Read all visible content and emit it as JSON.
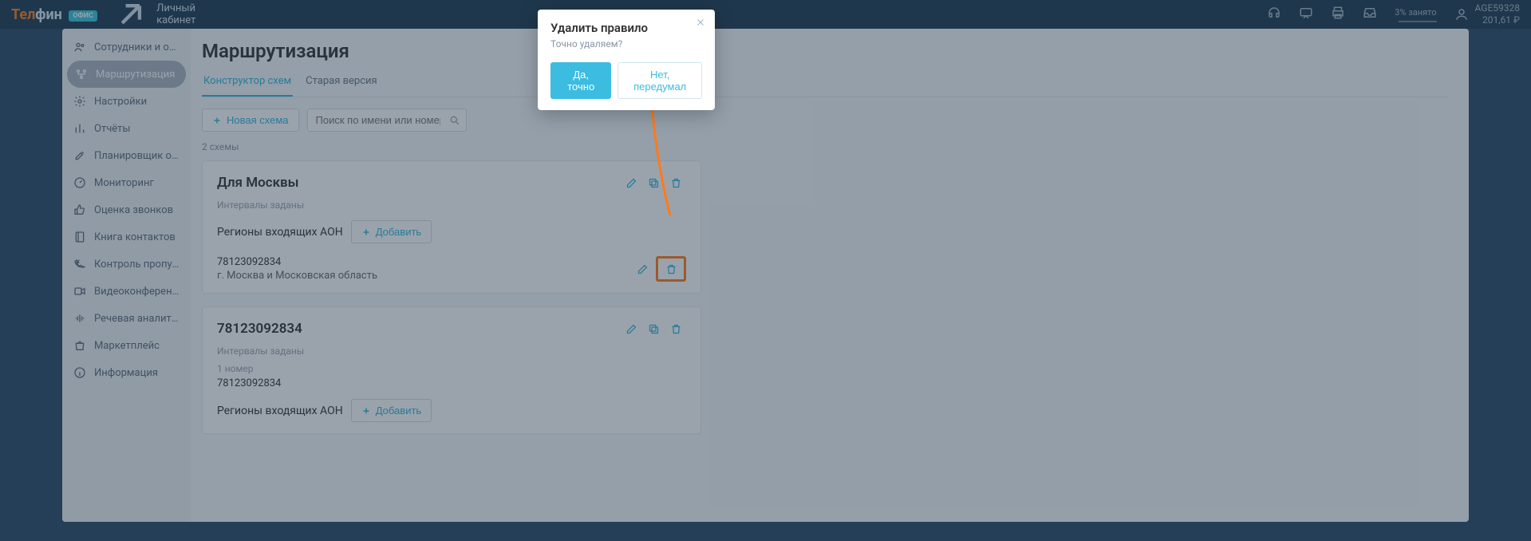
{
  "brand": {
    "part1": "Тел",
    "part2": "фин",
    "badge": "ОФИС"
  },
  "header": {
    "cabinet": "Личный кабинет",
    "busy_pct": "3% занято",
    "account_name": "AGE59328",
    "account_balance": "201,61 ₽"
  },
  "sidebar": {
    "items": [
      "Сотрудники и очереди",
      "Маршрутизация",
      "Настройки",
      "Отчёты",
      "Планировщик обзвонов",
      "Мониторинг",
      "Оценка звонков",
      "Книга контактов",
      "Контроль пропущенных",
      "Видеоконференция",
      "Речевая аналитика",
      "Маркетплейс",
      "Информация"
    ],
    "active_index": 1
  },
  "page": {
    "title": "Маршрутизация",
    "tabs": [
      "Конструктор схем",
      "Старая версия"
    ],
    "active_tab": 0,
    "new_scheme": "Новая схема",
    "search_placeholder": "Поиск по имени или номеру",
    "count": "2 схемы"
  },
  "schemes": [
    {
      "title": "Для Москвы",
      "intervals": "Интервалы заданы",
      "aon_label": "Регионы входящих АОН",
      "add_label": "Добавить",
      "entries": [
        {
          "number": "78123092834",
          "region": "г. Москва и Московская область"
        }
      ]
    },
    {
      "title": "78123092834",
      "intervals": "Интервалы заданы",
      "one_num_label": "1 номер",
      "one_num_value": "78123092834",
      "aon_label": "Регионы входящих АОН",
      "add_label": "Добавить"
    }
  ],
  "modal": {
    "title": "Удалить правило",
    "sub": "Точно удаляем?",
    "confirm": "Да, точно",
    "cancel": "Нет, передумал"
  }
}
